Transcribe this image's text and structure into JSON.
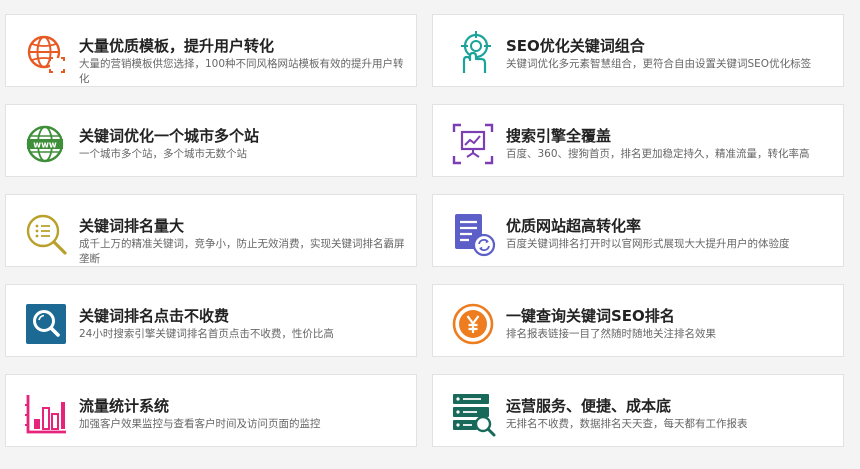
{
  "features": [
    {
      "title": "大量优质模板，提升用户转化",
      "desc": "大量的营销模板供您选择，100种不同风格网站模板有效的提升用户转化",
      "icon": "globe-target-icon"
    },
    {
      "title": "SEO优化关键词组合",
      "desc": "关键词优化多元素智慧组合，更符合自由设置关键词SEO优化标签",
      "icon": "hand-target-icon"
    },
    {
      "title": "关键词优化一个城市多个站",
      "desc": "一个城市多个站，多个城市无数个站",
      "icon": "www-globe-icon"
    },
    {
      "title": "搜索引擎全覆盖",
      "desc": "百度、360、搜狗首页，排名更加稳定持久，精准流量，转化率高",
      "icon": "presentation-chart-icon"
    },
    {
      "title": "关键词排名量大",
      "desc": "成千上万的精准关键词，竞争小，防止无效消费，实现关键词排名霸屏垄断",
      "icon": "search-list-icon"
    },
    {
      "title": "优质网站超高转化率",
      "desc": "百度关键词排名打开时以官网形式展现大大提升用户的体验度",
      "icon": "document-refresh-icon"
    },
    {
      "title": "关键词排名点击不收费",
      "desc": "24小时搜索引擎关键词排名首页点击不收费，性价比高",
      "icon": "magnifier-icon"
    },
    {
      "title": "一键查询关键词SEO排名",
      "desc": "排名报表链接一目了然随时随地关注排名效果",
      "icon": "yen-coin-icon"
    },
    {
      "title": "流量统计系统",
      "desc": "加强客户效果监控与查看客户时间及访问页面的监控",
      "icon": "bar-chart-icon"
    },
    {
      "title": "运营服务、便捷、成本底",
      "desc": "无排名不收费，数据排名天天查，每天都有工作报表",
      "icon": "server-search-icon"
    }
  ]
}
